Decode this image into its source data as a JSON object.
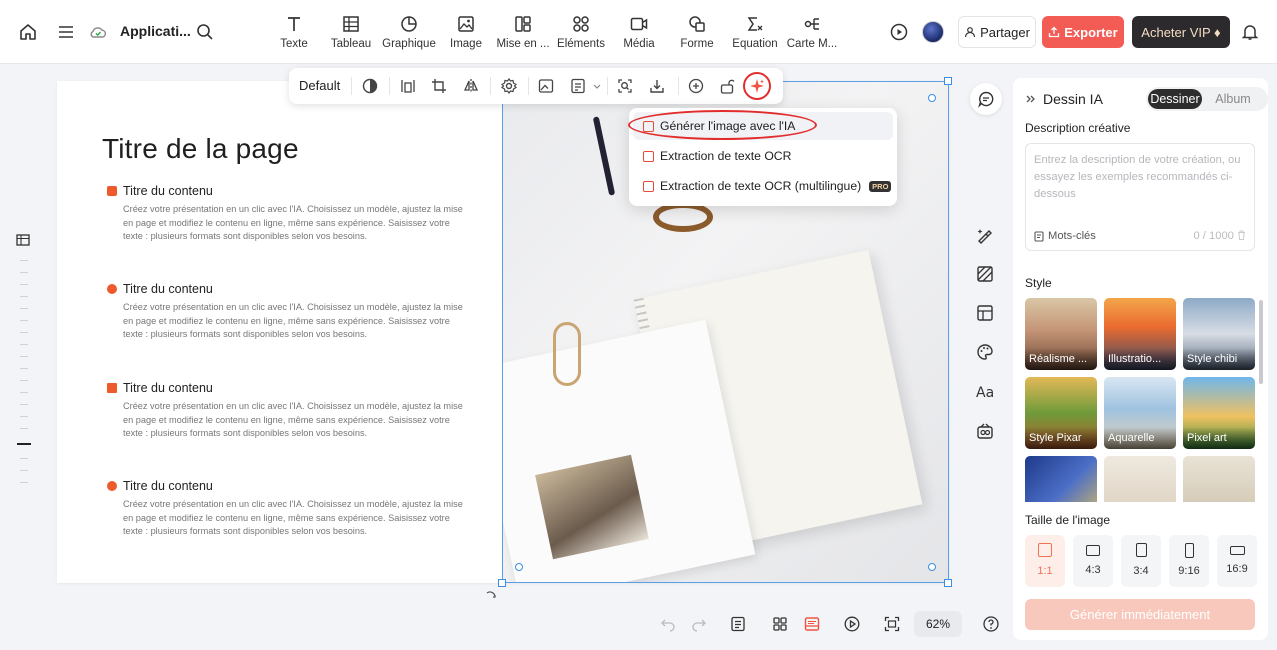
{
  "header": {
    "app_title": "Applicati...",
    "tools": [
      {
        "label": "Texte",
        "icon": "text-icon"
      },
      {
        "label": "Tableau",
        "icon": "table-icon"
      },
      {
        "label": "Graphique",
        "icon": "chart-icon"
      },
      {
        "label": "Image",
        "icon": "image-icon"
      },
      {
        "label": "Mise en ...",
        "icon": "layout-icon"
      },
      {
        "label": "Éléments",
        "icon": "elements-icon"
      },
      {
        "label": "Média",
        "icon": "media-icon"
      },
      {
        "label": "Forme",
        "icon": "shape-icon"
      },
      {
        "label": "Équation",
        "icon": "equation-icon"
      },
      {
        "label": "Carte M...",
        "icon": "mindmap-icon"
      }
    ],
    "share_label": "Partager",
    "export_label": "Exporter",
    "vip_label": "Acheter VIP ♦"
  },
  "slide": {
    "title": "Titre de la page",
    "items": [
      {
        "title": "Titre du contenu",
        "body": "Créez votre présentation en un clic avec l'IA. Choisissez un modèle, ajustez la mise en page et modifiez le contenu en ligne, même sans expérience. Saisissez votre texte : plusieurs formats sont disponibles selon vos besoins."
      },
      {
        "title": "Titre du contenu",
        "body": "Créez votre présentation en un clic avec l'IA. Choisissez un modèle, ajustez la mise en page et modifiez le contenu en ligne, même sans expérience. Saisissez votre texte : plusieurs formats sont disponibles selon vos besoins."
      },
      {
        "title": "Titre du contenu",
        "body": "Créez votre présentation en un clic avec l'IA. Choisissez un modèle, ajustez la mise en page et modifiez le contenu en ligne, même sans expérience. Saisissez votre texte : plusieurs formats sont disponibles selon vos besoins."
      },
      {
        "title": "Titre du contenu",
        "body": "Créez votre présentation en un clic avec l'IA. Choisissez un modèle, ajustez la mise en page et modifiez le contenu en ligne, même sans expérience. Saisissez votre texte : plusieurs formats sont disponibles selon vos besoins."
      }
    ]
  },
  "image_toolbar": {
    "style_label": "Default"
  },
  "ai_menu": {
    "items": [
      {
        "label": "Générer l'image avec l'IA"
      },
      {
        "label": "Extraction de texte OCR"
      },
      {
        "label": "Extraction de texte OCR (multilingue)",
        "badge": "PRO"
      }
    ]
  },
  "panel": {
    "title": "Dessin IA",
    "tabs": [
      "Dessiner",
      "Album"
    ],
    "desc_label": "Description créative",
    "desc_placeholder": "Entrez la description de votre création, ou essayez les exemples recommandés ci-dessous",
    "keywords_label": "Mots-clés",
    "counter": "0 / 1000",
    "style_label": "Style",
    "styles": [
      "Réalisme ...",
      "Illustratio...",
      "Style chibi",
      "Style Pixar",
      "Aquarelle",
      "Pixel art",
      "",
      "",
      ""
    ],
    "size_label": "Taille de l'image",
    "sizes": [
      "1:1",
      "4:3",
      "3:4",
      "9:16",
      "16:9"
    ],
    "selected_size": "1:1",
    "generate_label": "Générer immédiatement"
  },
  "bottom": {
    "zoom": "62%"
  },
  "colors": {
    "accent_red": "#f25c55",
    "selection_blue": "#3a8ee6",
    "annotation_red": "#e22d2d"
  }
}
